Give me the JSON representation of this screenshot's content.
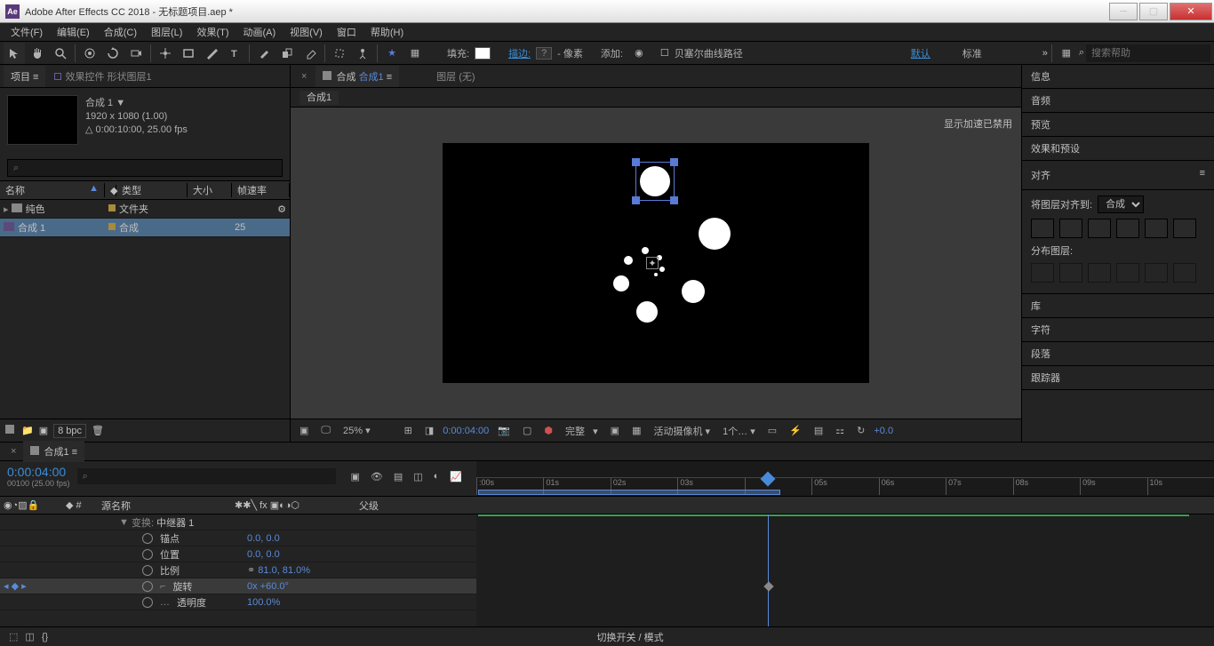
{
  "app": {
    "title": "Adobe After Effects CC 2018 - 无标题项目.aep *"
  },
  "menu": [
    "文件(F)",
    "编辑(E)",
    "合成(C)",
    "图层(L)",
    "效果(T)",
    "动画(A)",
    "视图(V)",
    "窗口",
    "帮助(H)"
  ],
  "toolbar": {
    "fill_label": "填充:",
    "stroke_label": "描边:",
    "stroke_help": "?",
    "px_label": "- 像素",
    "add_label": "添加:",
    "bezier_label": "贝塞尔曲线路径",
    "default_label": "默认",
    "standard_label": "标准",
    "search_placeholder": "搜索帮助"
  },
  "project": {
    "tab_project": "项目",
    "tab_effects": "效果控件 形状图层1",
    "comp_name": "合成 1",
    "resolution": "1920 x 1080 (1.00)",
    "duration": "△ 0:00:10:00, 25.00 fps",
    "search_placeholder": "⌕",
    "col_name": "名称",
    "col_type": "类型",
    "col_size": "大小",
    "col_fps": "帧速率",
    "rows": [
      {
        "name": "纯色",
        "type": "文件夹",
        "fps": ""
      },
      {
        "name": "合成 1",
        "type": "合成",
        "fps": "25"
      }
    ],
    "bpc": "8 bpc"
  },
  "viewer": {
    "tab_prefix": "合成",
    "tab_name": "合成1",
    "layer_label": "图层 (无)",
    "accel_text": "显示加速已禁用",
    "zoom": "25%",
    "timecode": "0:00:04:00",
    "quality": "完整",
    "camera": "活动摄像机",
    "views": "1个…",
    "exposure": "+0.0"
  },
  "right": {
    "info": "信息",
    "audio": "音频",
    "preview": "预览",
    "presets": "效果和预设",
    "align": "对齐",
    "align_to_label": "将图层对齐到:",
    "align_to_value": "合成",
    "distribute_label": "分布图层:",
    "library": "库",
    "character": "字符",
    "paragraph": "段落",
    "tracker": "跟踪器"
  },
  "timeline": {
    "tab": "合成1",
    "timecode": "0:00:04:00",
    "fps": "00100 (25.00 fps)",
    "col_src": "源名称",
    "col_parent": "父级",
    "ruler": [
      ":00s",
      "01s",
      "02s",
      "03s",
      "",
      "05s",
      "06s",
      "07s",
      "08s",
      "09s",
      "10s"
    ],
    "repeater": "中继器 1",
    "props": [
      {
        "name": "锚点",
        "value": "0.0, 0.0"
      },
      {
        "name": "位置",
        "value": "0.0, 0.0"
      },
      {
        "name": "比例",
        "value": "81.0, 81.0%",
        "link": true
      },
      {
        "name": "旋转",
        "value": "0x +60.0°",
        "key": true,
        "sel": true
      },
      {
        "name": "透明度",
        "value": "100.0%",
        "ellipsis": true
      }
    ],
    "switch_label": "切换开关 / 模式"
  }
}
